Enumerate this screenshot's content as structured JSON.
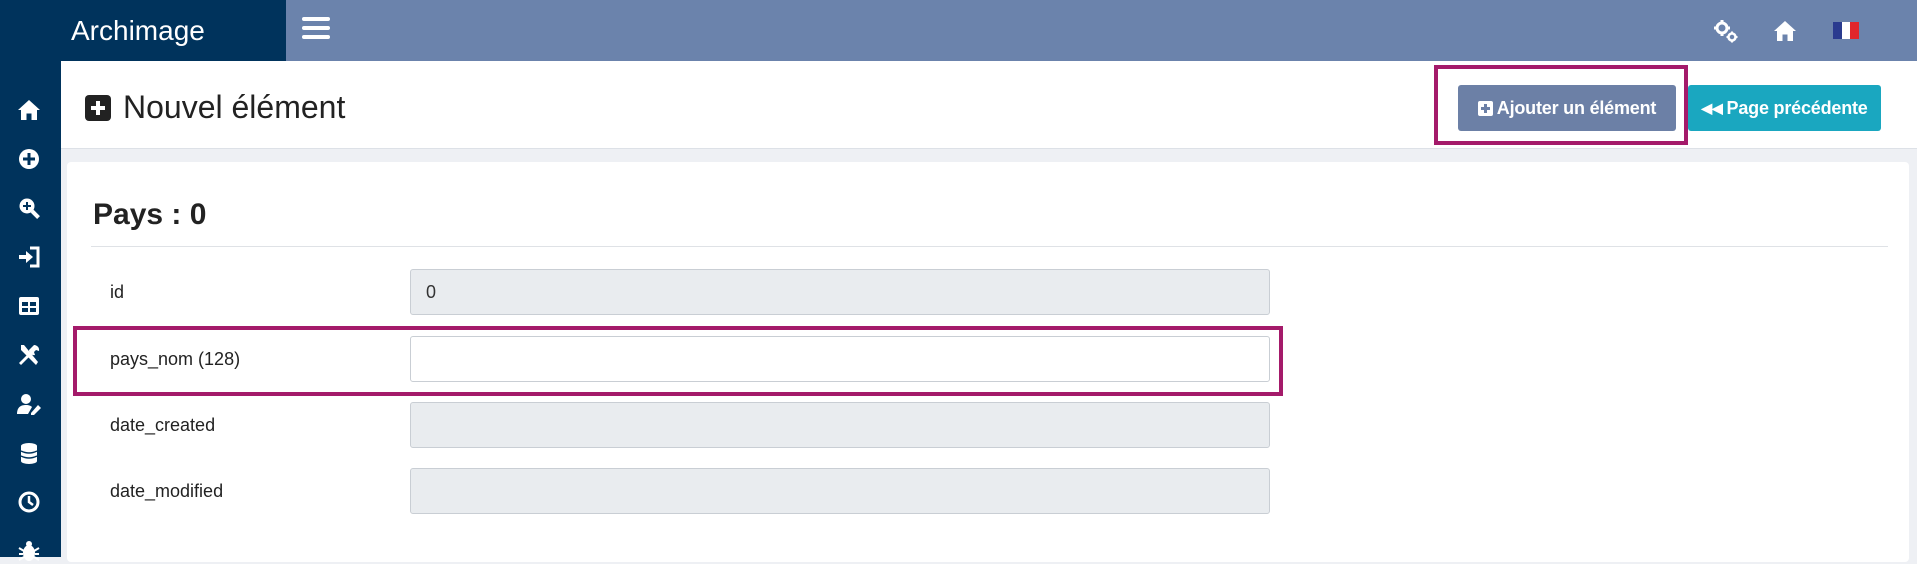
{
  "app": {
    "title": "Archimage"
  },
  "topbar": {
    "icons": [
      "cogs-icon",
      "home-icon",
      "flag-fr-icon"
    ],
    "flag_colors": [
      "#2a3b8f",
      "#ffffff",
      "#e1262b"
    ]
  },
  "sidebar": {
    "icons": [
      "home-icon",
      "plus-circle-icon",
      "search-plus-icon",
      "sign-in-icon",
      "table-icon",
      "tools-icon",
      "user-edit-icon",
      "database-icon",
      "clock-icon",
      "bug-icon"
    ]
  },
  "header": {
    "title": "Nouvel élément",
    "add_button": "Ajouter un élément",
    "back_button": "Page précédente"
  },
  "form": {
    "section_title": "Pays : 0",
    "fields": [
      {
        "label": "id",
        "value": "0",
        "readonly": true
      },
      {
        "label": "pays_nom (128)",
        "value": "",
        "readonly": false
      },
      {
        "label": "date_created",
        "value": "",
        "readonly": true
      },
      {
        "label": "date_modified",
        "value": "",
        "readonly": true
      }
    ]
  },
  "colors": {
    "brand": "#00335c",
    "topbar": "#6b83ac",
    "add_button": "#6c80a6",
    "back_button": "#1aa7c0",
    "highlight": "#a41a6a"
  }
}
